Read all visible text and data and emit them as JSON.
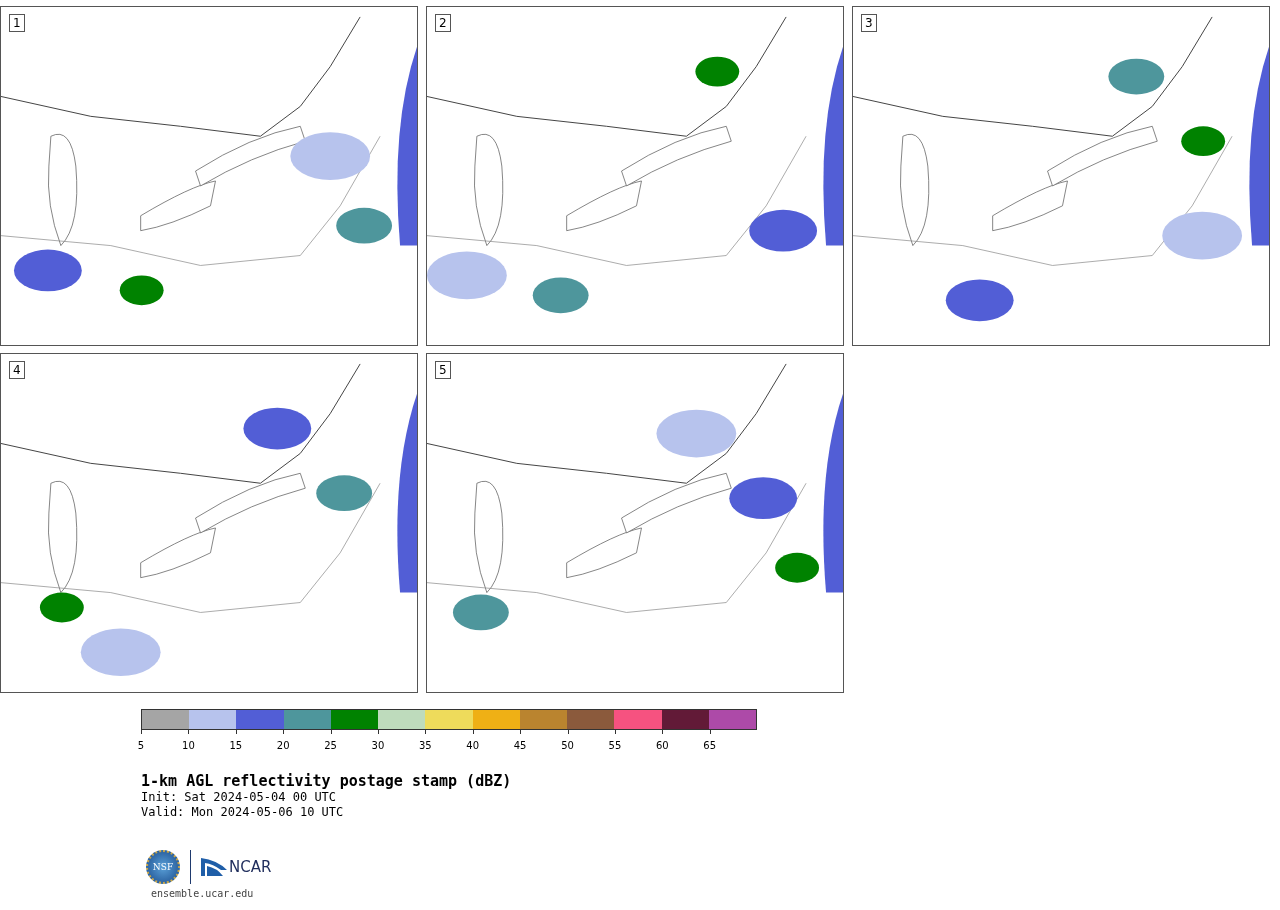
{
  "panels": [
    {
      "label": "1"
    },
    {
      "label": "2"
    },
    {
      "label": "3"
    },
    {
      "label": "4"
    },
    {
      "label": "5"
    }
  ],
  "colorbar": {
    "bins": [
      {
        "color": "#a5a5a5"
      },
      {
        "color": "#b7c3ed"
      },
      {
        "color": "#525ed6"
      },
      {
        "color": "#4e969c"
      },
      {
        "color": "#008200"
      },
      {
        "color": "#bedbbc"
      },
      {
        "color": "#eedb5b"
      },
      {
        "color": "#efb015"
      },
      {
        "color": "#ba842f"
      },
      {
        "color": "#8b5a3c"
      },
      {
        "color": "#f65280"
      },
      {
        "color": "#621a37"
      },
      {
        "color": "#ad4aa8"
      }
    ],
    "ticks": [
      "5",
      "10",
      "15",
      "20",
      "25",
      "30",
      "35",
      "40",
      "45",
      "50",
      "55",
      "60",
      "65"
    ]
  },
  "title": "1-km AGL reflectivity postage stamp (dBZ)",
  "init": " Init: Sat 2024-05-04 00 UTC",
  "valid": "Valid: Mon 2024-05-06 10 UTC",
  "logos": {
    "nsf": "NSF",
    "ncar": "NCAR"
  },
  "site": "ensemble.ucar.edu"
}
